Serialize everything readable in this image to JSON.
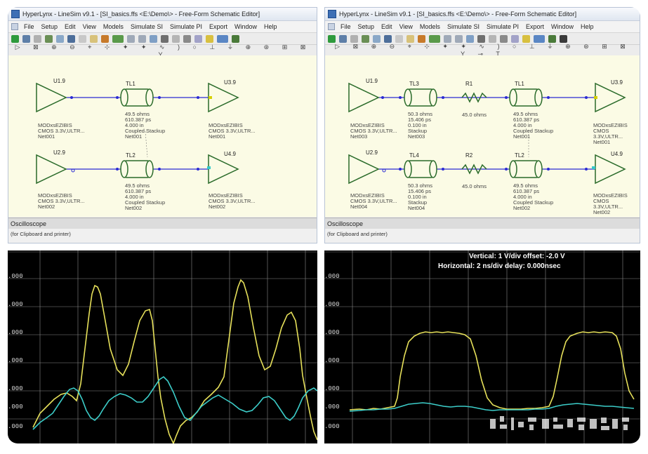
{
  "left_window": {
    "title": "HyperLynx - LineSim v9.1 - [SI_basics.ffs <E:\\Demo\\> - Free-Form Schematic Editor]",
    "menu": [
      "File",
      "Setup",
      "Edit",
      "View",
      "Models",
      "Simulate SI",
      "Simulate PI",
      "Export",
      "Window",
      "Help"
    ],
    "toolbar2": "▷ ⊠ ⊕ ⊖ ⌖ ⊹ ✦ ✦ ∿ ) ○ ⊥ ⏚ ⊕ ⊛ ⊞ ⊠ Y",
    "oscilloscope_label": "Oscilloscope",
    "clipboard_label": "(for Clipboard and printer)",
    "net1": {
      "driver": {
        "ref": "U1.9",
        "model": "MODxsEZIBIS",
        "tech": "CMOS 3.3V,ULTR...",
        "net": "Net001"
      },
      "tline": {
        "ref": "TL1",
        "imp": "49.5 ohms",
        "delay": "610.387 ps",
        "len": "4.000 in",
        "stack": "Coupled Stackup",
        "net": "Net001"
      },
      "receiver": {
        "ref": "U3.9",
        "model": "MODxsEZIBIS",
        "tech": "CMOS 3.3V,ULTR...",
        "net": "Net001"
      }
    },
    "net2": {
      "driver": {
        "ref": "U2.9",
        "model": "MODxsEZIBIS",
        "tech": "CMOS 3.3V,ULTR...",
        "net": "Net002"
      },
      "tline": {
        "ref": "TL2",
        "imp": "49.5 ohms",
        "delay": "610.387 ps",
        "len": "4.000 in",
        "stack": "Coupled Stackup",
        "net": "Net002"
      },
      "receiver": {
        "ref": "U4.9",
        "model": "MODxsEZIBIS",
        "tech": "CMOS 3.3V,ULTR...",
        "net": "Net002"
      }
    },
    "scope": {
      "y_ticks": [
        ".000",
        ".000",
        ".000",
        ".000",
        ".000",
        ".000",
        ".000"
      ],
      "trace_colors": {
        "net1": "#e6e05a",
        "net2": "#3ccdc9"
      }
    }
  },
  "right_window": {
    "title": "HyperLynx - LineSim v9.1 - [SI_basics.ffs <E:\\Demo\\> - Free-Form Schematic Editor]",
    "menu": [
      "File",
      "Setup",
      "Edit",
      "View",
      "Models",
      "Simulate SI",
      "Simulate PI",
      "Export",
      "Window",
      "Help"
    ],
    "toolbar2": "▷ ⊠ ⊕ ⊖ ⌖ ⊹ ✦ ✦ ∿ ) ○ ⊥ ⏚ ⊕ ⊛ ⊞ ⊠ Y ⊸ T",
    "oscilloscope_label": "Oscilloscope",
    "clipboard_label": "(for Clipboard and printer)",
    "net1": {
      "driver": {
        "ref": "U1.9",
        "model": "MODxsEZIBIS",
        "tech": "CMOS 3.3V,ULTR...",
        "net": "Net003"
      },
      "tline_a": {
        "ref": "TL3",
        "imp": "50.3 ohms",
        "delay": "15.406 ps",
        "len": "0.100 in",
        "stack": "Stackup",
        "net": "Net003"
      },
      "resistor": {
        "ref": "R1",
        "value": "45.0 ohms"
      },
      "tline_b": {
        "ref": "TL1",
        "imp": "49.5 ohms",
        "delay": "610.387 ps",
        "len": "4.000 in",
        "stack": "Coupled Stackup",
        "net": "Net001"
      },
      "receiver": {
        "ref": "U3.9",
        "model": "MODxsEZIBIS",
        "tech": "CMOS 3.3V,ULTR...",
        "net": "Net001"
      }
    },
    "net2": {
      "driver": {
        "ref": "U2.9",
        "model": "MODxsEZIBIS",
        "tech": "CMOS 3.3V,ULTR...",
        "net": "Net004"
      },
      "tline_a": {
        "ref": "TL4",
        "imp": "50.3 ohms",
        "delay": "15.406 ps",
        "len": "0.100 in",
        "stack": "Stackup",
        "net": "Net004"
      },
      "resistor": {
        "ref": "R2",
        "value": "45.0 ohms"
      },
      "tline_b": {
        "ref": "TL2",
        "imp": "49.5 ohms",
        "delay": "610.387 ps",
        "len": "4.000 in",
        "stack": "Coupled Stackup",
        "net": "Net002"
      },
      "receiver": {
        "ref": "U4.9",
        "model": "MODxsEZIBIS",
        "tech": "CMOS 3.3V,ULTR...",
        "net": "Net002"
      }
    },
    "scope": {
      "vertical_text": "Vertical: 1  V/div  offset: -2.0 V",
      "horizontal_text": "Horizontal: 2 ns/div  delay: 0.000nsec",
      "y_ticks": [
        ".000",
        ".000",
        ".000",
        ".000",
        ".000",
        ".000",
        ".000"
      ],
      "trace_colors": {
        "net1": "#e6e05a",
        "net2": "#3ccdc9"
      }
    }
  }
}
